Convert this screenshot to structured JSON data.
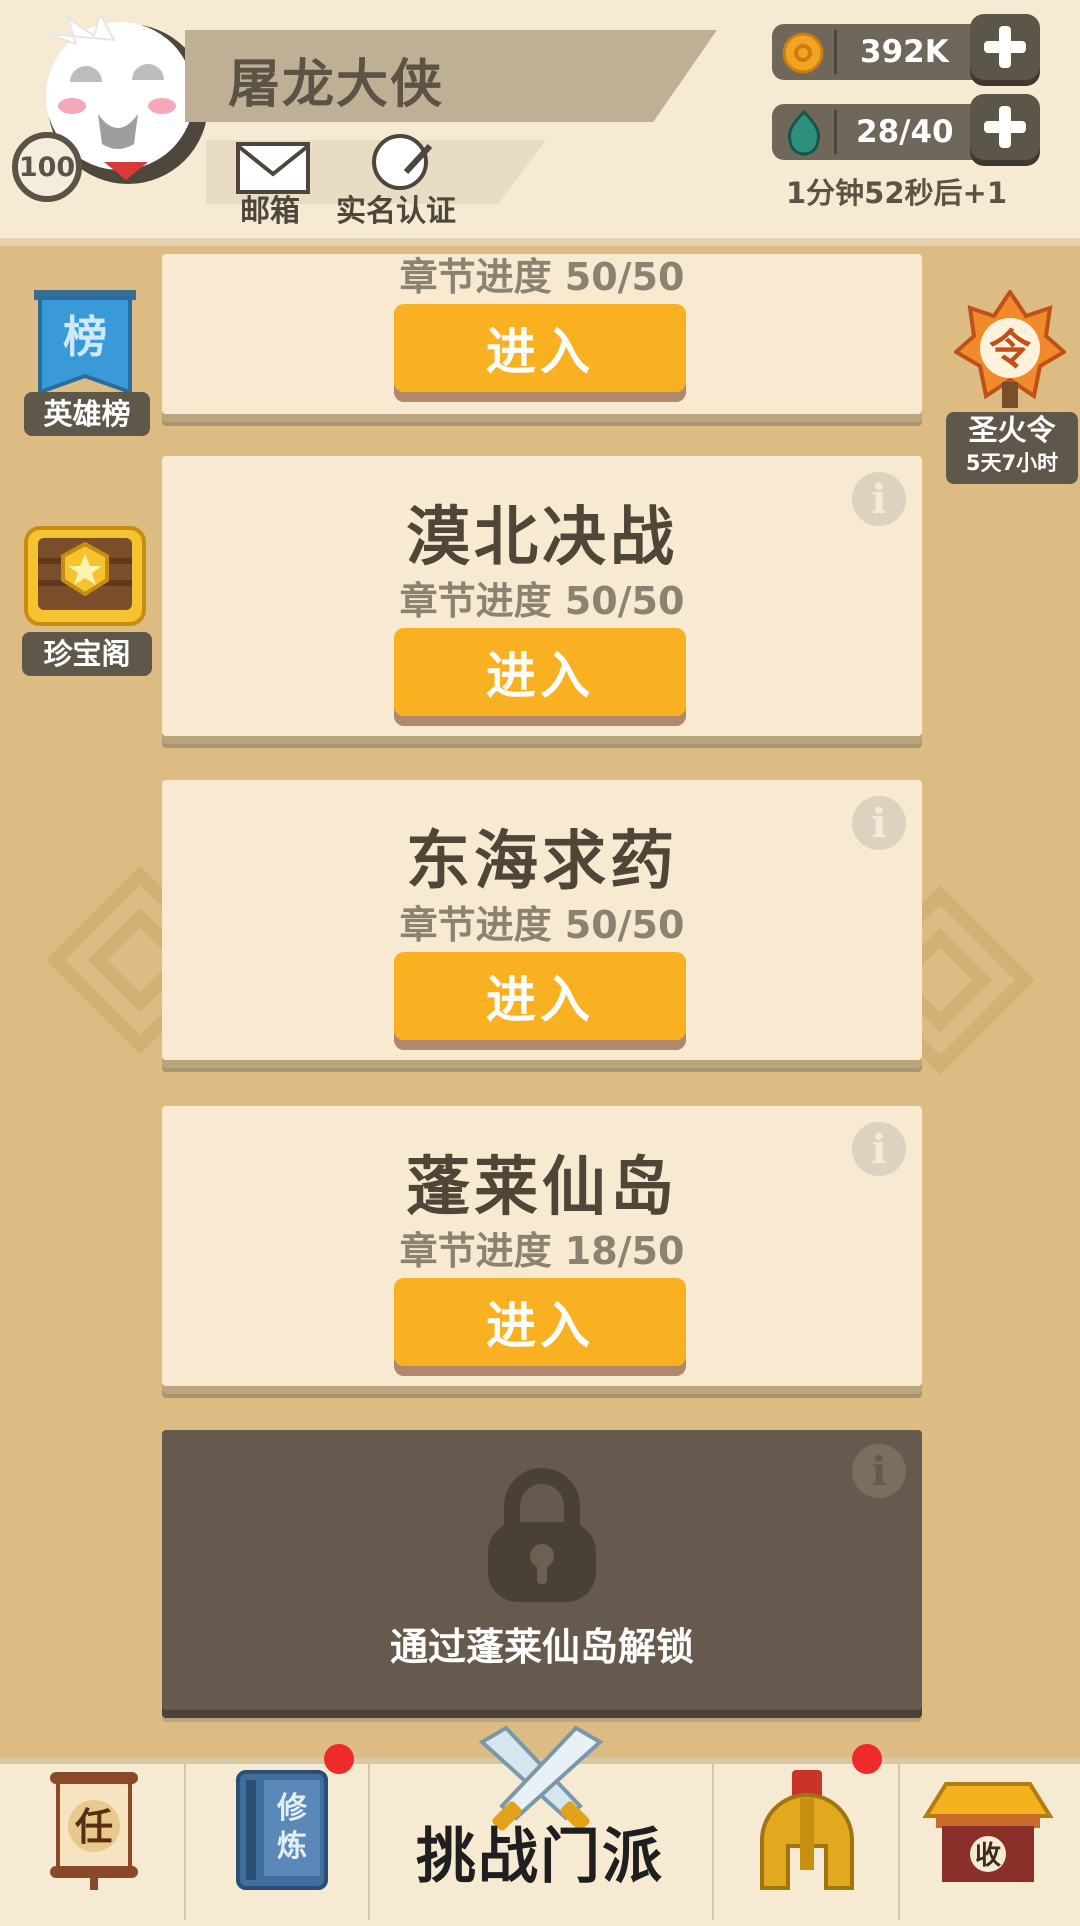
{
  "player": {
    "name": "屠龙大侠",
    "level": "100",
    "mail_label": "邮箱",
    "realname_label": "实名认证"
  },
  "resources": {
    "coins": "392K",
    "stamina": "28/40",
    "refill_timer": "1分钟52秒后+1"
  },
  "side_left": [
    {
      "label": "英雄榜",
      "icon": "ranking-banner-icon",
      "glyph": "榜"
    },
    {
      "label": "珍宝阁",
      "icon": "treasure-chest-icon"
    }
  ],
  "side_right": {
    "label": "圣火令",
    "countdown": "5天7小时",
    "glyph": "令"
  },
  "chapters": [
    {
      "title": "",
      "progress": "章节进度 50/50",
      "button": "进入"
    },
    {
      "title": "漠北决战",
      "progress": "章节进度 50/50",
      "button": "进入"
    },
    {
      "title": "东海求药",
      "progress": "章节进度 50/50",
      "button": "进入"
    },
    {
      "title": "蓬莱仙岛",
      "progress": "章节进度 18/50",
      "button": "进入"
    }
  ],
  "locked_chapter": {
    "message": "通过蓬莱仙岛解锁"
  },
  "bottom_nav": {
    "task_glyph": "任",
    "cultivate_glyph": "修炼",
    "challenge_label": "挑战门派",
    "collect_glyph": "收"
  },
  "colors": {
    "background": "#dcbc82",
    "card": "#f8ead0",
    "enter_button": "#f9b021",
    "locked_card": "#655a4d",
    "notification": "#ef2a2a"
  }
}
